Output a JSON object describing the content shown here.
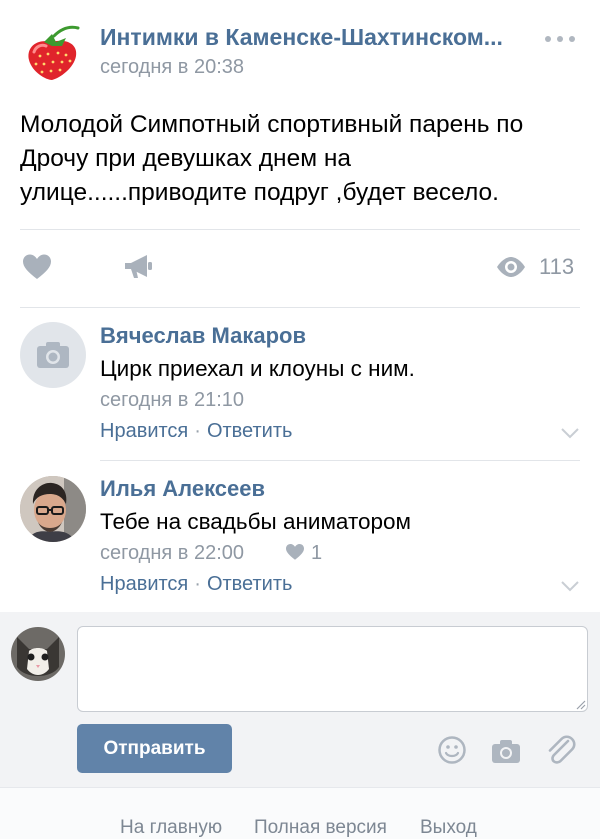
{
  "post": {
    "group_name": "Интимки в Каменске-Шахтинском...",
    "time": "сегодня в 20:38",
    "text": "Молодой Симпотный спортивный парень по Дрочу при девушках днем на улице......приводите подруг ,будет весело.",
    "views": "113",
    "icons": {
      "avatar": "strawberry-icon",
      "more": "more-dots-icon",
      "like": "heart-icon",
      "share": "megaphone-icon",
      "views": "eye-icon"
    }
  },
  "comments": [
    {
      "author": "Вячеслав Макаров",
      "text": "Цирк приехал и клоуны с ним.",
      "time": "сегодня в 21:10",
      "like_label": "Нравится",
      "reply_label": "Ответить",
      "avatar": "camera-placeholder-icon"
    },
    {
      "author": "Илья Алексеев",
      "text": "Тебе на свадьбы аниматором",
      "time": "сегодня в 22:00",
      "likes": "1",
      "like_label": "Нравится",
      "reply_label": "Ответить",
      "avatar": "user-photo"
    }
  ],
  "reply": {
    "input_value": "",
    "send_label": "Отправить",
    "icons": [
      "smile-icon",
      "camera-icon",
      "paperclip-icon"
    ]
  },
  "footer": {
    "home": "На главную",
    "full_version": "Полная версия",
    "logout": "Выход"
  },
  "colors": {
    "link": "#4a6f96",
    "meta": "#8f98a3",
    "button": "#6183a9",
    "reply_bg": "#f2f3f5"
  }
}
